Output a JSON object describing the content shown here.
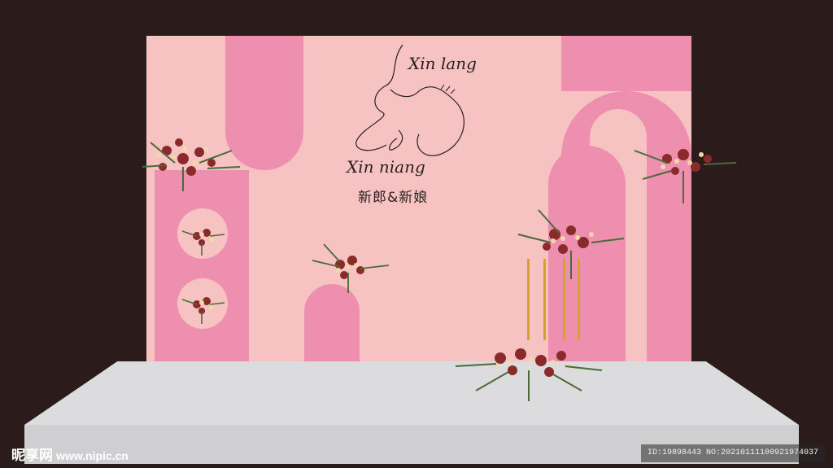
{
  "backdrop": {
    "signature_top": "Xin lang",
    "signature_bottom": "Xin niang",
    "couple_text": "新郎&新娘"
  },
  "colors": {
    "background": "#2b1b1b",
    "backdrop_light_pink": "#f6c2c2",
    "backdrop_dark_pink": "#ee8fb0",
    "stage": "#dcdcde",
    "stand_gold": "#d4a227"
  },
  "watermark": {
    "site_name": "昵享网",
    "site_url": "www.nipic.cn",
    "image_id": "ID:19898443 NO:20210111100921974037"
  }
}
